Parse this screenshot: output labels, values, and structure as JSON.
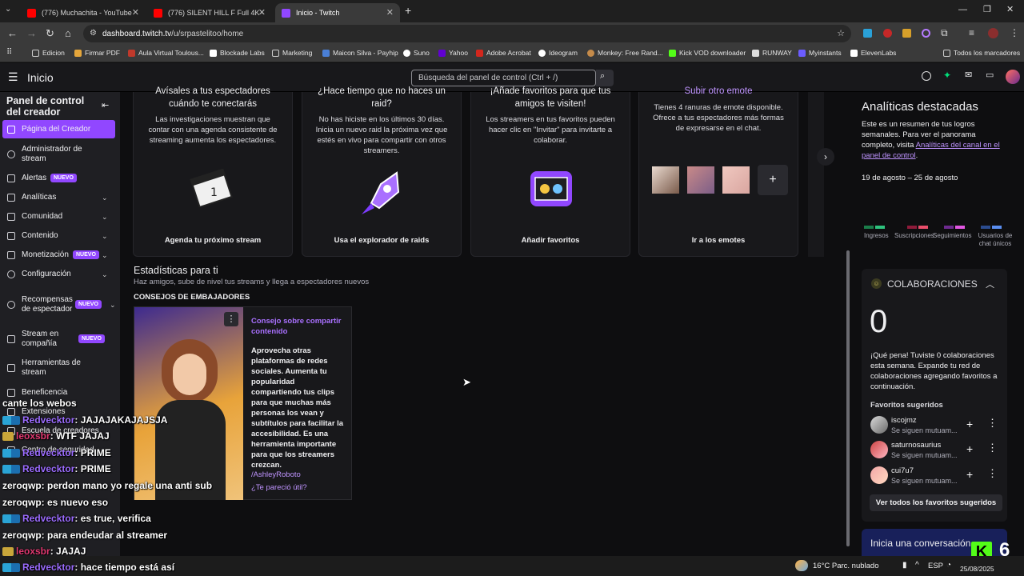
{
  "browser": {
    "tabs": [
      {
        "title": "(776) Muchachita - YouTube",
        "active": false
      },
      {
        "title": "(776) SILENT HILL F Full 4K Gam",
        "active": false
      },
      {
        "title": "Inicio - Twitch",
        "active": true
      }
    ],
    "new_tab_label": "+",
    "url_host": "dashboard.twitch.tv",
    "url_path": "/u/srpastelitoo/home",
    "bookmarks": [
      "Edicion",
      "Firmar PDF",
      "Aula Virtual Toulous...",
      "Blockade Labs",
      "Marketing",
      "Maicon Silva - Payhip",
      "Suno",
      "Yahoo",
      "Adobe Acrobat",
      "Ideogram",
      "Monkey: Free Rand...",
      "Kick VOD downloader",
      "RUNWAY",
      "Myinstants",
      "ElevenLabs"
    ],
    "all_bookmarks": "Todos los marcadores"
  },
  "twitch_nav": {
    "home_label": "Inicio",
    "search_placeholder": "Búsqueda del panel de control (Ctrl + /)"
  },
  "sidebar": {
    "title": "Panel de control del creador",
    "items": [
      {
        "label": "Página del Creador",
        "active": true
      },
      {
        "label": "Administrador de stream"
      },
      {
        "label": "Alertas",
        "badge": "NUEVO"
      },
      {
        "label": "Analíticas"
      },
      {
        "label": "Comunidad"
      },
      {
        "label": "Contenido"
      },
      {
        "label": "Monetización",
        "badge": "NUEVO"
      },
      {
        "label": "Configuración"
      },
      {
        "label": "Recompensas de espectador",
        "badge": "NUEVO"
      },
      {
        "label": "Stream en compañía",
        "badge": "NUEVO"
      },
      {
        "label": "Herramientas de stream"
      },
      {
        "label": "Beneficencia"
      },
      {
        "label": "Extensiones"
      },
      {
        "label": "Escuela de creadores"
      },
      {
        "label": "Centro de seguridad"
      }
    ]
  },
  "cards": [
    {
      "title": "Avísales a tus espectadores cuándo te conectarás",
      "desc": "Las investigaciones muestran que contar con una agenda consistente de streaming aumenta los espectadores.",
      "button": "Agenda tu próximo stream"
    },
    {
      "title": "¿Hace tiempo que no haces un raid?",
      "desc": "No has hiciste en los últimos 30 días. Inicia un nuevo raid la próxima vez que estés en vivo para compartir con otros streamers.",
      "button": "Usa el explorador de raids"
    },
    {
      "title": "¡Añade favoritos para que tus amigos te visiten!",
      "desc": "Los streamers en tus favoritos pueden hacer clic en \"Invitar\" para invitarte a colaborar.",
      "button": "Añadir favoritos"
    },
    {
      "title": "Subir otro emote",
      "desc": "Tienes 4 ranuras de emote disponible. Ofrece a tus espectadores más formas de expresarse en el chat.",
      "button": "Ir a los emotes"
    }
  ],
  "stats": {
    "title": "Estadísticas para ti",
    "subtitle": "Haz amigos, sube de nivel tus streams y llega a espectadores nuevos",
    "section": "CONSEJOS DE EMBAJADORES",
    "tip_title": "Consejo sobre compartir contenido",
    "tip_body": "Aprovecha otras plataformas de redes sociales. Aumenta tu popularidad compartiendo tus clips para que muchas más personas los vean y subtítulos para facilitar la accesibilidad. Es una herramienta importante para que los streamers crezcan.",
    "tip_author": "/AshleyRoboto",
    "tip_feedback": "¿Te pareció útil?"
  },
  "analytics": {
    "title": "Analíticas destacadas",
    "desc": "Este es un resumen de tus logros semanales. Para ver el panorama completo, visita",
    "link": "Analíticas del canal en el panel de control",
    "date_range": "19 de agosto – 25 de agosto",
    "legend": [
      "Ingresos",
      "Suscripciones",
      "Seguimientos",
      "Usuarios de chat únicos"
    ]
  },
  "collab": {
    "title": "COLABORACIONES",
    "count": "0",
    "message": "¡Qué pena! Tuviste 0 colaboraciones esta semana. Expande tu red de colaboraciones agregando favoritos a continuación.",
    "suggested_title": "Favoritos sugeridos",
    "suggested": [
      {
        "name": "iscojmz",
        "sub": "Se siguen mutuam..."
      },
      {
        "name": "saturnosaurius",
        "sub": "Se siguen mutuam..."
      },
      {
        "name": "cui7u7",
        "sub": "Se siguen mutuam..."
      }
    ],
    "see_all": "Ver todos los favoritos sugeridos",
    "next_card": "Inicia una conversación"
  },
  "chat_overlay": [
    {
      "user": "cante los webos",
      "msg": ""
    },
    {
      "user": "Redvecktor",
      "msg": ": JAJAJAKAJAJSJA"
    },
    {
      "user": "leoxsbr",
      "msg": ": WTF JAJAJ"
    },
    {
      "user": "Redvecktor",
      "msg": ": PRIME"
    },
    {
      "user": "Redvecktor",
      "msg": ": PRIME"
    },
    {
      "user": "zeroqwp",
      "msg": ": perdon mano yo regale una anti sub"
    },
    {
      "user": "zeroqwp",
      "msg": ": es nuevo eso"
    },
    {
      "user": "Redvecktor",
      "msg": ": es true, verifica"
    },
    {
      "user": "zeroqwp",
      "msg": ": para endeudar al streamer"
    },
    {
      "user": "leoxsbr",
      "msg": ": JAJAJ"
    },
    {
      "user": "Redvecktor",
      "msg": ": hace tiempo está así"
    }
  ],
  "kick_count": "6",
  "taskbar": {
    "weather": "16°C  Parc. nublado",
    "lang": "ESP",
    "date": "25/08/2025"
  }
}
